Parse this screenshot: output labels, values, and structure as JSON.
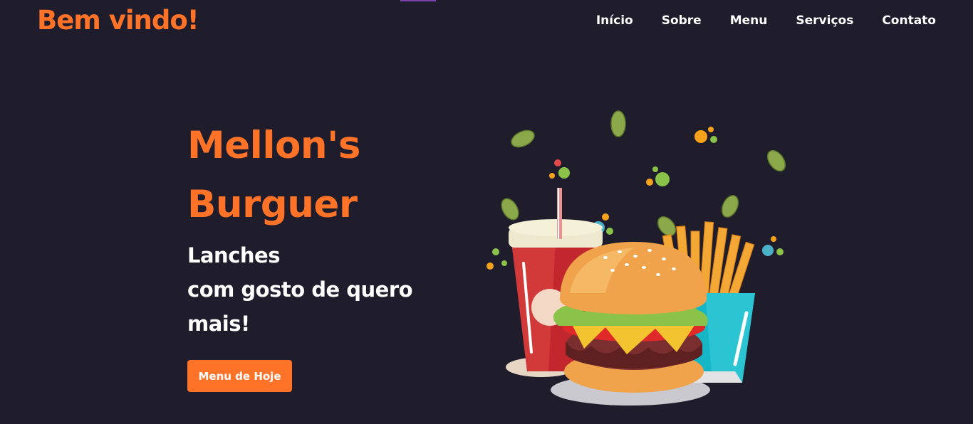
{
  "brand": {
    "title": "Bem vindo!"
  },
  "nav": {
    "items": [
      {
        "label": "Início"
      },
      {
        "label": "Sobre"
      },
      {
        "label": "Menu"
      },
      {
        "label": "Serviços"
      },
      {
        "label": "Contato"
      }
    ]
  },
  "hero": {
    "title_line1": "Mellon's",
    "title_line2": "Burguer",
    "subtitle_line1": "Lanches",
    "subtitle_line2": "com gosto de quero",
    "subtitle_line3": "mais!",
    "cta_label": "Menu de Hoje"
  },
  "colors": {
    "background": "#1f1c2c",
    "accent": "#ff7328",
    "text": "#ffffff"
  }
}
